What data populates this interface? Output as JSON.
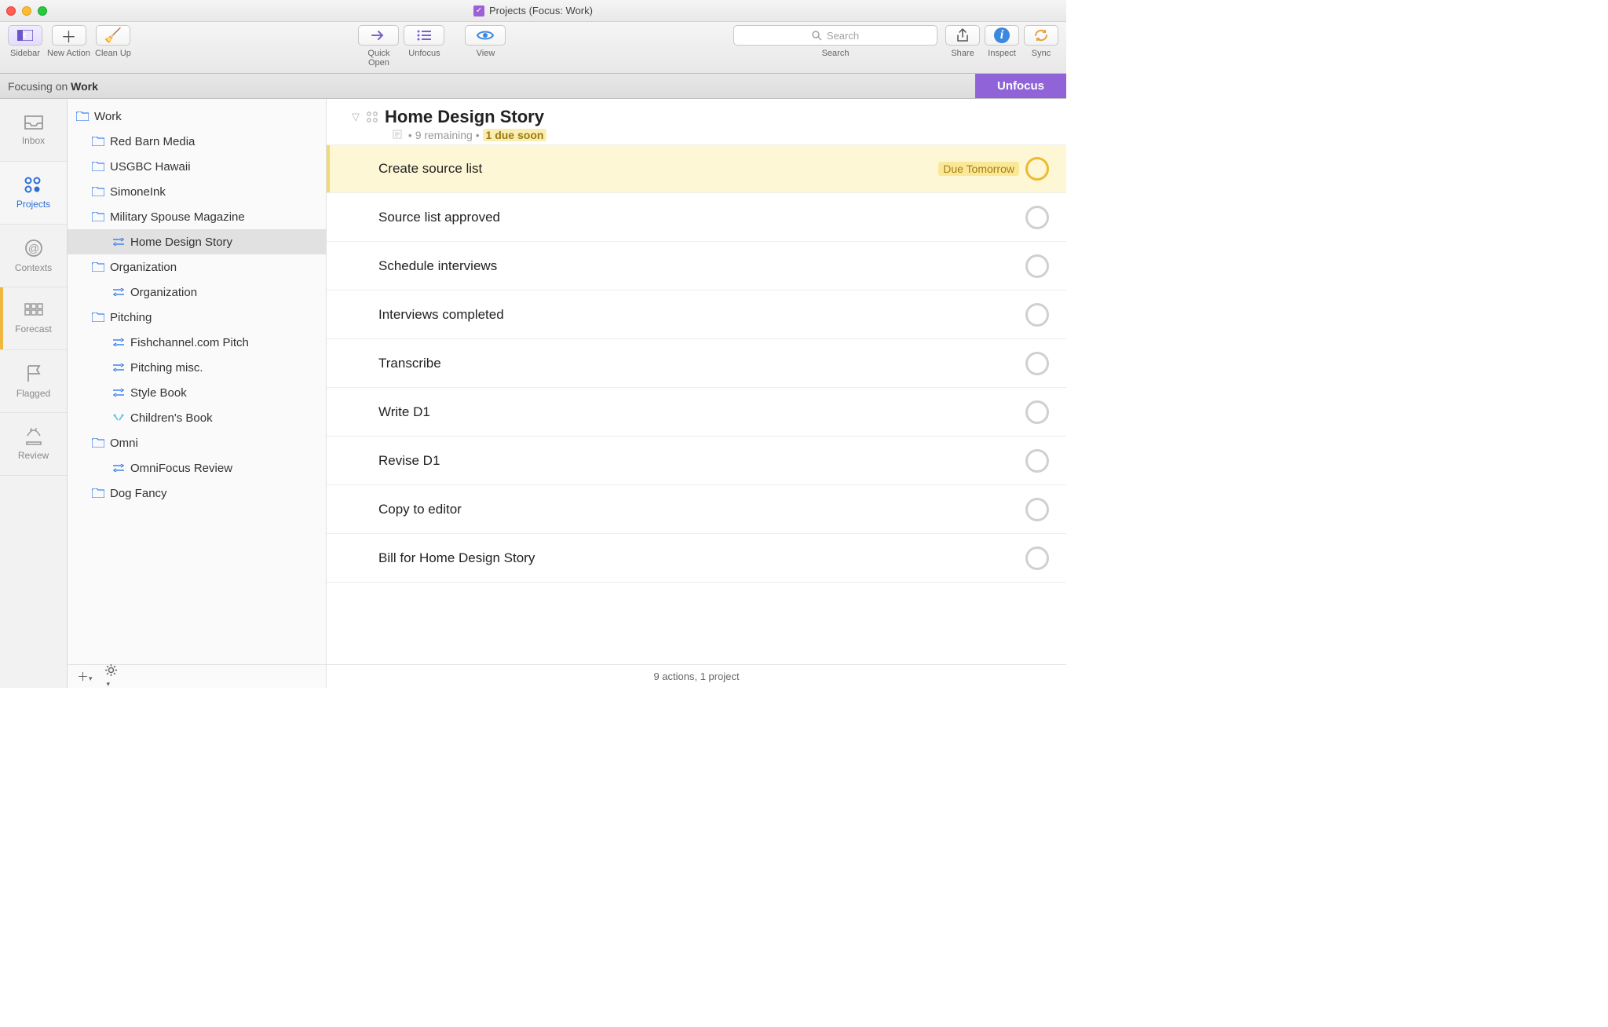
{
  "window": {
    "title": "Projects (Focus: Work)"
  },
  "toolbar": {
    "sidebar": "Sidebar",
    "new_action": "New Action",
    "clean_up": "Clean Up",
    "quick_open": "Quick Open",
    "unfocus": "Unfocus",
    "view": "View",
    "search_placeholder": "Search",
    "search_label": "Search",
    "share": "Share",
    "inspect": "Inspect",
    "sync": "Sync"
  },
  "focusbar": {
    "prefix": "Focusing on ",
    "subject": "Work",
    "unfocus": "Unfocus"
  },
  "rail": {
    "inbox": "Inbox",
    "projects": "Projects",
    "contexts": "Contexts",
    "forecast": "Forecast",
    "flagged": "Flagged",
    "review": "Review"
  },
  "sidebar": {
    "items": [
      {
        "type": "folder",
        "label": "Work",
        "indent": 0
      },
      {
        "type": "folder",
        "label": "Red Barn Media",
        "indent": 1
      },
      {
        "type": "folder",
        "label": "USGBC Hawaii",
        "indent": 1
      },
      {
        "type": "folder",
        "label": "SimoneInk",
        "indent": 1
      },
      {
        "type": "folder",
        "label": "Military Spouse Magazine",
        "indent": 1
      },
      {
        "type": "project",
        "label": "Home Design Story",
        "indent": 2,
        "selected": true
      },
      {
        "type": "folder",
        "label": "Organization",
        "indent": 1
      },
      {
        "type": "project",
        "label": "Organization",
        "indent": 2
      },
      {
        "type": "folder",
        "label": "Pitching",
        "indent": 1
      },
      {
        "type": "project",
        "label": "Fishchannel.com Pitch",
        "indent": 2
      },
      {
        "type": "project",
        "label": "Pitching misc.",
        "indent": 2
      },
      {
        "type": "project",
        "label": "Style Book",
        "indent": 2
      },
      {
        "type": "single",
        "label": "Children's Book",
        "indent": 2
      },
      {
        "type": "folder",
        "label": "Omni",
        "indent": 1
      },
      {
        "type": "project",
        "label": "OmniFocus Review",
        "indent": 2
      },
      {
        "type": "folder",
        "label": "Dog Fancy",
        "indent": 1
      }
    ]
  },
  "outline": {
    "title": "Home Design Story",
    "remaining": "9 remaining",
    "due_soon": "1 due soon",
    "tasks": [
      {
        "title": "Create source list",
        "due_soon": true,
        "due_label": "Due Tomorrow"
      },
      {
        "title": "Source list approved"
      },
      {
        "title": "Schedule interviews"
      },
      {
        "title": "Interviews completed"
      },
      {
        "title": "Transcribe"
      },
      {
        "title": "Write D1"
      },
      {
        "title": "Revise D1"
      },
      {
        "title": "Copy to editor"
      },
      {
        "title": "Bill for Home Design Story"
      }
    ]
  },
  "footer": {
    "status": "9 actions, 1 project"
  }
}
